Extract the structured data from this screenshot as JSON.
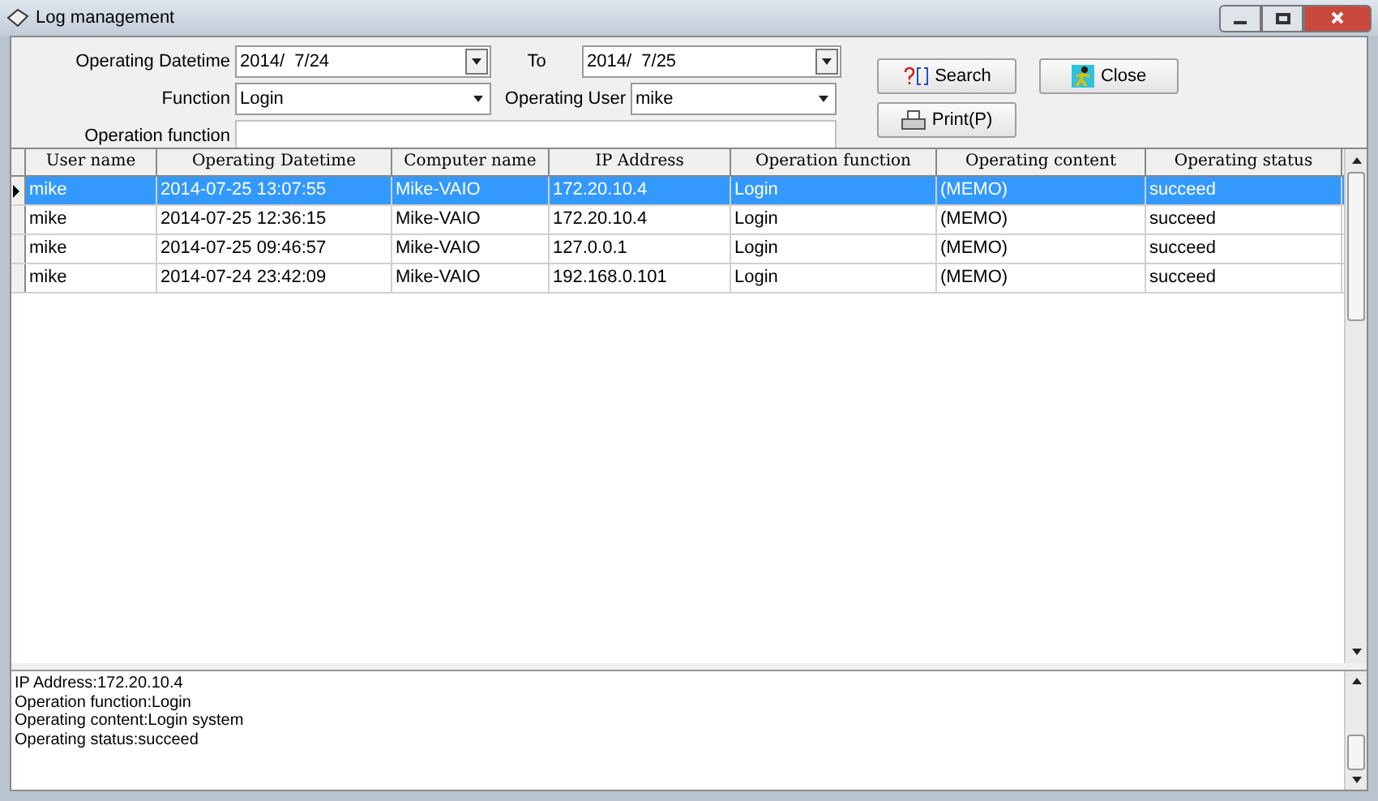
{
  "window": {
    "title": "Log management"
  },
  "filters": {
    "datetime_label": "Operating Datetime",
    "date_from": "2014/  7/24",
    "to_label": "To",
    "date_to": "2014/  7/25",
    "function_label": "Function",
    "function_value": "Login",
    "user_label": "Operating User",
    "user_value": "mike",
    "opfunc_label": "Operation function"
  },
  "buttons": [
    {
      "label": "Search",
      "kind": "search"
    },
    {
      "label": "Close",
      "kind": "close"
    },
    {
      "label": "Print(P)",
      "kind": "print"
    }
  ],
  "table": {
    "columns": [
      "User name",
      "Operating Datetime",
      "Computer name",
      "IP Address",
      "Operation function",
      "Operating content",
      "Operating status"
    ],
    "rows": [
      {
        "selected": true,
        "cells": [
          "mike",
          "2014-07-25 13:07:55",
          "Mike-VAIO",
          "172.20.10.4",
          "Login",
          "(MEMO)",
          "succeed"
        ]
      },
      {
        "selected": false,
        "cells": [
          "mike",
          "2014-07-25 12:36:15",
          "Mike-VAIO",
          "172.20.10.4",
          "Login",
          "(MEMO)",
          "succeed"
        ]
      },
      {
        "selected": false,
        "cells": [
          "mike",
          "2014-07-25 09:46:57",
          "Mike-VAIO",
          "127.0.0.1",
          "Login",
          "(MEMO)",
          "succeed"
        ]
      },
      {
        "selected": false,
        "cells": [
          "mike",
          "2014-07-24 23:42:09",
          "Mike-VAIO",
          "192.168.0.101",
          "Login",
          "(MEMO)",
          "succeed"
        ]
      }
    ]
  },
  "details": [
    "IP Address:172.20.10.4",
    "Operation function:Login",
    "Operating content:Login system",
    "Operating status:succeed"
  ]
}
